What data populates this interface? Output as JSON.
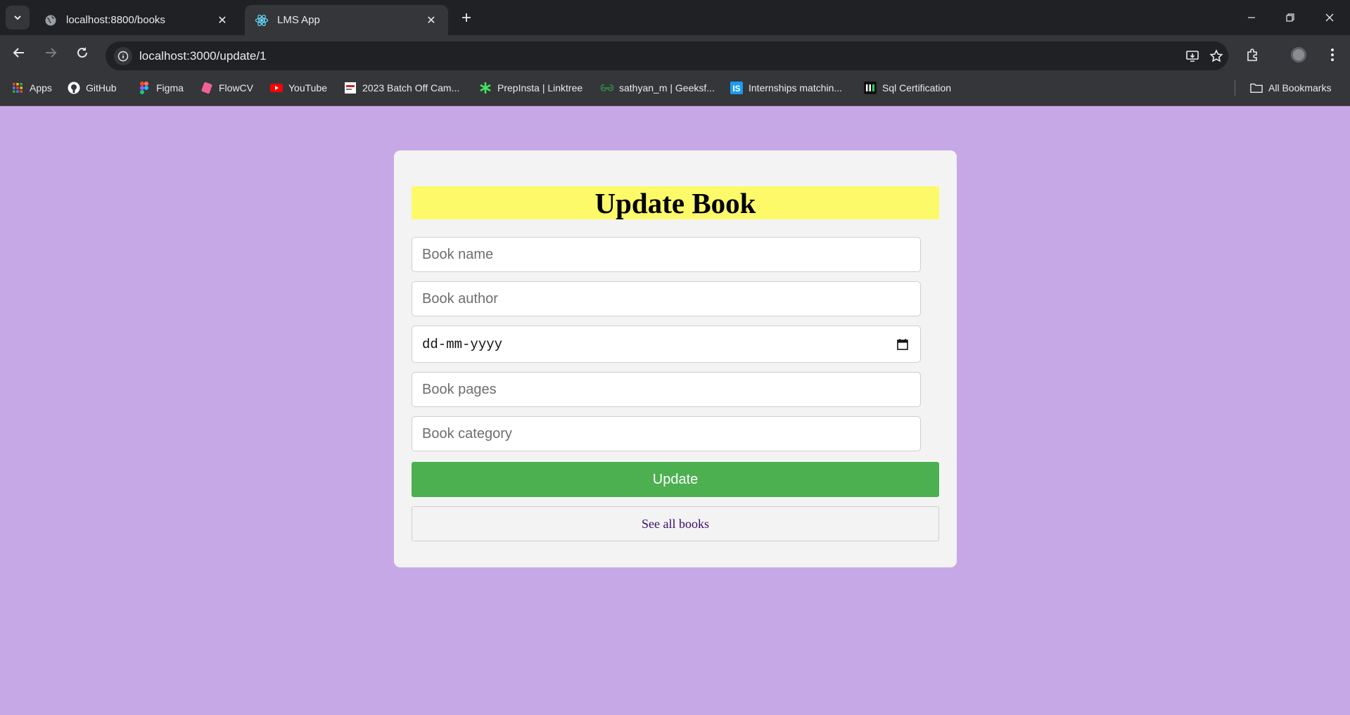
{
  "browser": {
    "tabs": [
      {
        "title": "localhost:8800/books",
        "active": false,
        "icon": "globe-icon"
      },
      {
        "title": "LMS App",
        "active": true,
        "icon": "react-icon"
      }
    ],
    "url": "localhost:3000/update/1",
    "bookmarks": [
      {
        "label": "Apps",
        "icon": "apps-grid-icon"
      },
      {
        "label": "GitHub",
        "icon": "github-icon"
      },
      {
        "label": "Figma",
        "icon": "figma-icon"
      },
      {
        "label": "FlowCV",
        "icon": "flowcv-icon"
      },
      {
        "label": "YouTube",
        "icon": "youtube-icon"
      },
      {
        "label": "2023 Batch Off Cam...",
        "icon": "site-icon"
      },
      {
        "label": "PrepInsta | Linktree",
        "icon": "linktree-icon"
      },
      {
        "label": "sathyan_m | Geeksf...",
        "icon": "geeksforgeeks-icon"
      },
      {
        "label": "Internships matchin...",
        "icon": "internshala-icon"
      },
      {
        "label": "Sql Certification",
        "icon": "hackerrank-icon"
      }
    ],
    "all_bookmarks_label": "All Bookmarks"
  },
  "form": {
    "heading": "Update Book",
    "fields": {
      "name_placeholder": "Book name",
      "author_placeholder": "Book author",
      "date_value": "dd-mm-yyyy",
      "pages_placeholder": "Book pages",
      "category_placeholder": "Book category"
    },
    "update_label": "Update",
    "see_all_label": "See all books"
  },
  "colors": {
    "page_bg": "#c7a8e6",
    "card_bg": "#f3f3f3",
    "heading_bg": "#fdfa69",
    "update_button": "#4caf50",
    "link": "#3a0a6b"
  }
}
